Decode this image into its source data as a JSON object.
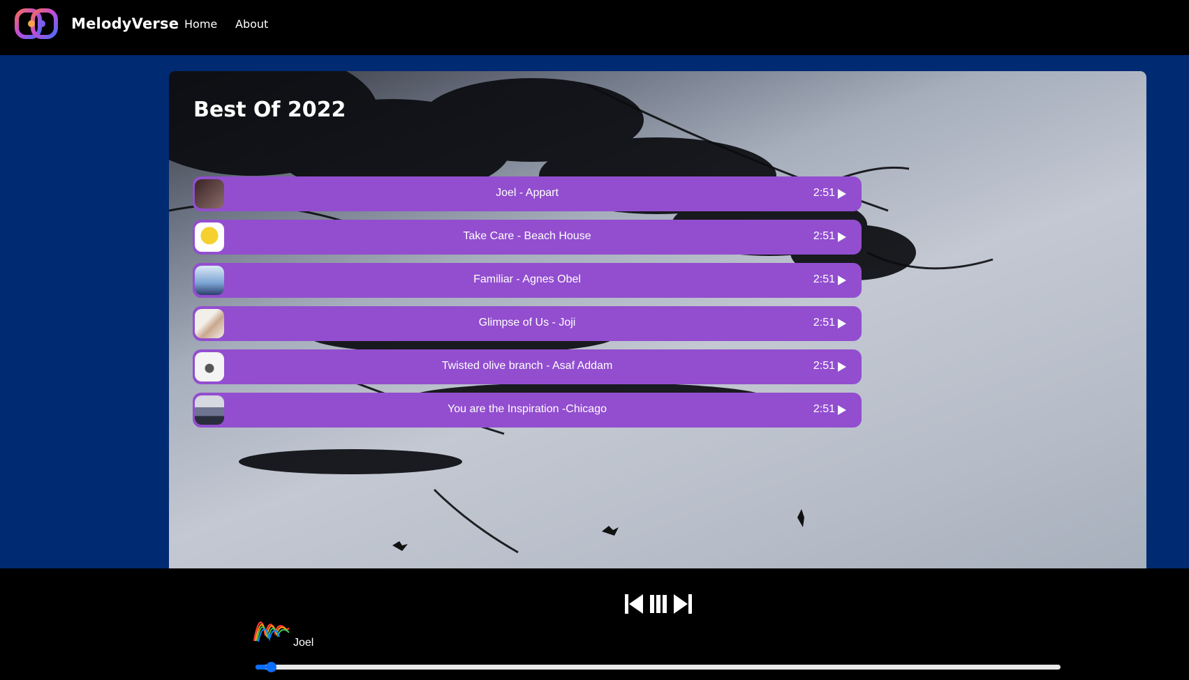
{
  "navbar": {
    "brand": "MelodyVerse",
    "links": [
      {
        "label": "Home"
      },
      {
        "label": "About"
      }
    ]
  },
  "playlist": {
    "title": "Best Of 2022",
    "songs": [
      {
        "title": "Joel - Appart",
        "duration": "2:51",
        "thumb_color": "#5a3a3a"
      },
      {
        "title": "Take Care - Beach House",
        "duration": "2:51",
        "thumb_color": "#f3e46a"
      },
      {
        "title": "Familiar - Agnes Obel",
        "duration": "2:51",
        "thumb_color": "#9ec4e8"
      },
      {
        "title": "Glimpse of Us - Joji",
        "duration": "2:51",
        "thumb_color": "#e7e2dc"
      },
      {
        "title": "Twisted olive branch - Asaf Addam",
        "duration": "2:51",
        "thumb_color": "#f2f2f2"
      },
      {
        "title": "You are the Inspiration -Chicago",
        "duration": "2:51",
        "thumb_color": "#8a8ea8"
      }
    ]
  },
  "player": {
    "now_playing": "Joel",
    "progress": 0.014,
    "accent_color": "#0d6efd"
  },
  "colors": {
    "background": "#002a72",
    "song_row": "#924ecf",
    "bars": "#000000"
  },
  "icons": [
    "logo-icon",
    "play-icon",
    "skip-back-icon",
    "pause-icon",
    "skip-forward-icon",
    "wave-icon"
  ]
}
